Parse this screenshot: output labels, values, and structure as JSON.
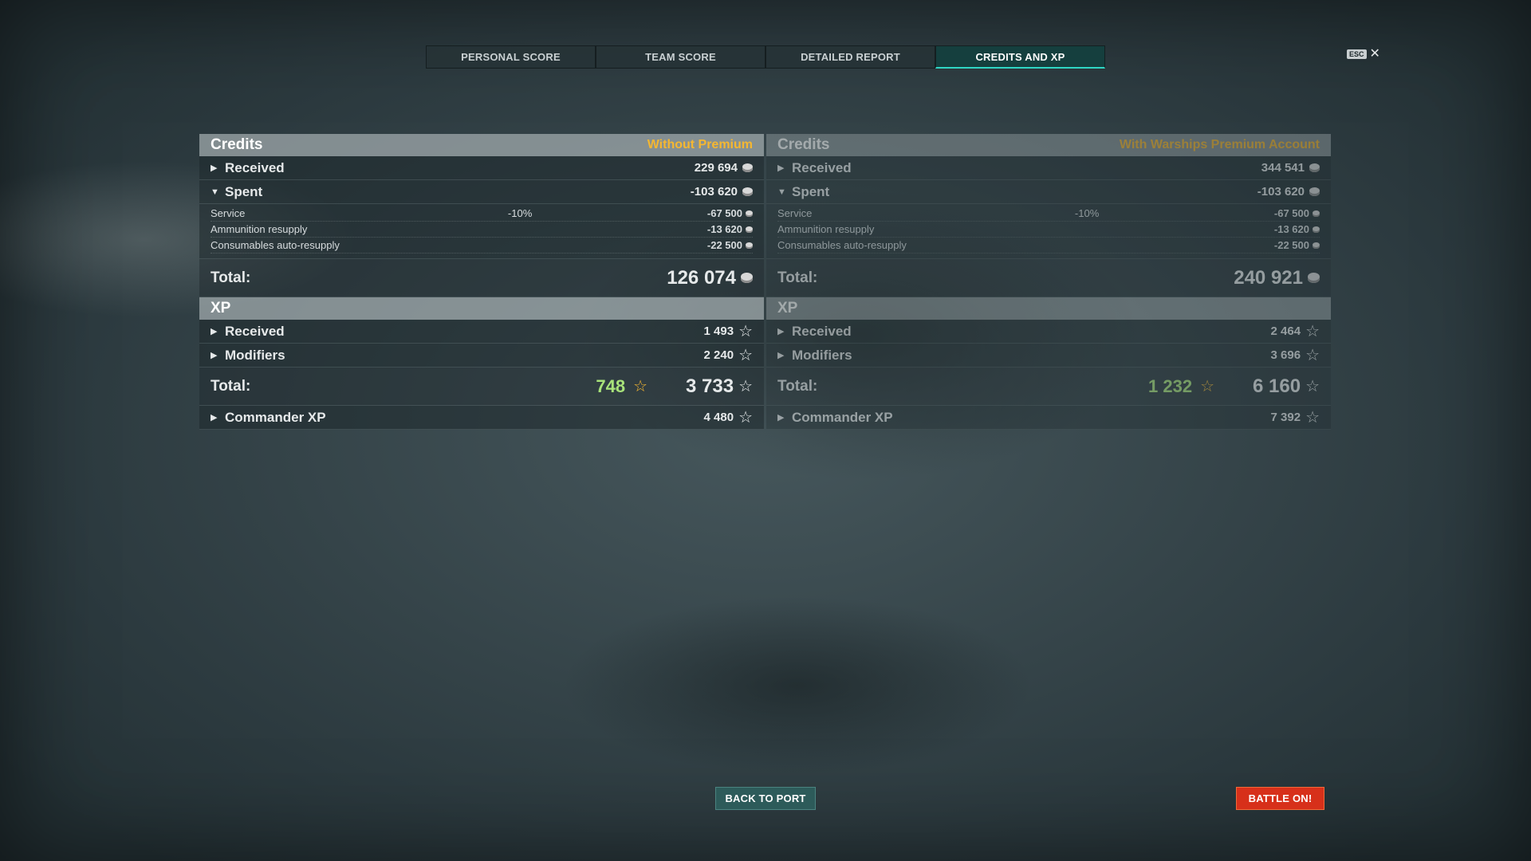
{
  "tabs": [
    {
      "label": "PERSONAL SCORE"
    },
    {
      "label": "TEAM SCORE"
    },
    {
      "label": "DETAILED REPORT"
    },
    {
      "label": "CREDITS AND XP",
      "active": true
    }
  ],
  "close": {
    "esc_label": "ESC",
    "x_label": "✕"
  },
  "left": {
    "credits": {
      "title": "Credits",
      "note": "Without Premium",
      "received": {
        "label": "Received",
        "value": "229 694"
      },
      "spent": {
        "label": "Spent",
        "value": "-103 620"
      },
      "details": [
        {
          "label": "Service",
          "pct": "-10%",
          "value": "-67 500"
        },
        {
          "label": "Ammunition resupply",
          "pct": "",
          "value": "-13 620"
        },
        {
          "label": "Consumables auto-resupply",
          "pct": "",
          "value": "-22 500"
        }
      ],
      "total": {
        "label": "Total:",
        "value": "126 074"
      }
    },
    "xp": {
      "title": "XP",
      "received": {
        "label": "Received",
        "value": "1 493"
      },
      "modifiers": {
        "label": "Modifiers",
        "value": "2 240"
      },
      "total": {
        "label": "Total:",
        "free": "748",
        "value": "3 733"
      },
      "commander": {
        "label": "Commander XP",
        "value": "4 480"
      }
    }
  },
  "right": {
    "credits": {
      "title": "Credits",
      "note": "With Warships Premium Account",
      "received": {
        "label": "Received",
        "value": "344 541"
      },
      "spent": {
        "label": "Spent",
        "value": "-103 620"
      },
      "details": [
        {
          "label": "Service",
          "pct": "-10%",
          "value": "-67 500"
        },
        {
          "label": "Ammunition resupply",
          "pct": "",
          "value": "-13 620"
        },
        {
          "label": "Consumables auto-resupply",
          "pct": "",
          "value": "-22 500"
        }
      ],
      "total": {
        "label": "Total:",
        "value": "240 921"
      }
    },
    "xp": {
      "title": "XP",
      "received": {
        "label": "Received",
        "value": "2 464"
      },
      "modifiers": {
        "label": "Modifiers",
        "value": "3 696"
      },
      "total": {
        "label": "Total:",
        "free": "1 232",
        "value": "6 160"
      },
      "commander": {
        "label": "Commander XP",
        "value": "7 392"
      }
    }
  },
  "buttons": {
    "back_to_port": "BACK TO PORT",
    "battle_on": "BATTLE ON!"
  },
  "colors": {
    "premium_note": "#f5b731",
    "free_xp": "#a8e27a",
    "active_tab_accent": "#2fd6c4",
    "battle_button": "#d7301a",
    "port_button": "#2d5b5a"
  },
  "icons": {
    "credits": "coin-icon",
    "xp": "star-icon",
    "expand": "caret-right-icon",
    "collapse": "caret-down-icon"
  }
}
